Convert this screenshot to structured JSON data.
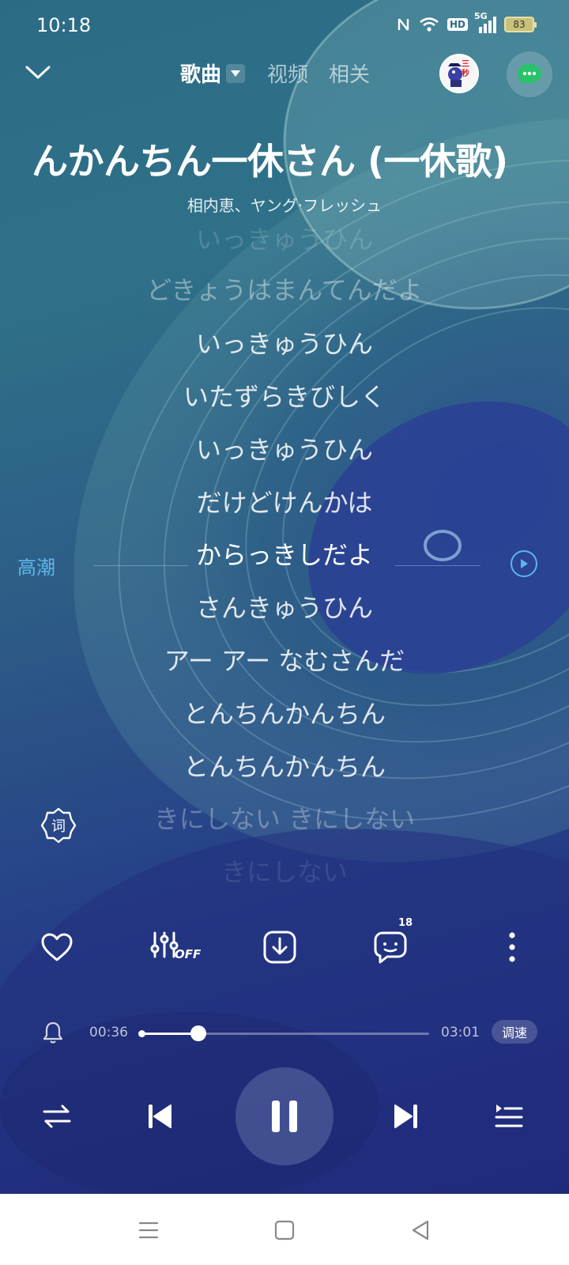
{
  "status_bar": {
    "time": "10:18",
    "hd": "HD",
    "network": "5G",
    "battery": "83",
    "icons": [
      "nfc-icon",
      "wifi-icon",
      "hd-icon",
      "5g-signal-icon",
      "battery-icon"
    ]
  },
  "nav": {
    "tabs": [
      {
        "label": "歌曲"
      },
      {
        "label": "视频"
      },
      {
        "label": "相关"
      }
    ],
    "avatar_text": "三秒"
  },
  "song": {
    "title": "んかんちん一休さん (一休歌)",
    "artist": "相内恵、ヤング·フレッシュ"
  },
  "lyrics": {
    "lines": [
      "いっきゅうひん",
      "どきょうはまんてんだよ",
      "いっきゅうひん",
      "いたずらきびしく",
      "いっきゅうひん",
      "だけどけんかは",
      "からっきしだよ",
      "さんきゅうひん",
      "アー アー なむさんだ",
      "とんちんかんちん",
      "とんちんかんちん",
      "きにしない きにしない",
      "きにしない"
    ],
    "climax_label": "高潮",
    "lyric_toggle_label": "词"
  },
  "actions": {
    "comment_count": "18",
    "eq_state": "OFF",
    "icons": [
      "heart-icon",
      "equalizer-icon",
      "download-icon",
      "comment-icon",
      "more-icon"
    ]
  },
  "player": {
    "current_time": "00:36",
    "total_time": "03:01",
    "progress_fraction": 0.2,
    "speed_label": "调速"
  },
  "colors": {
    "accent": "#5eb6ea",
    "chat_green": "#27c26a"
  }
}
